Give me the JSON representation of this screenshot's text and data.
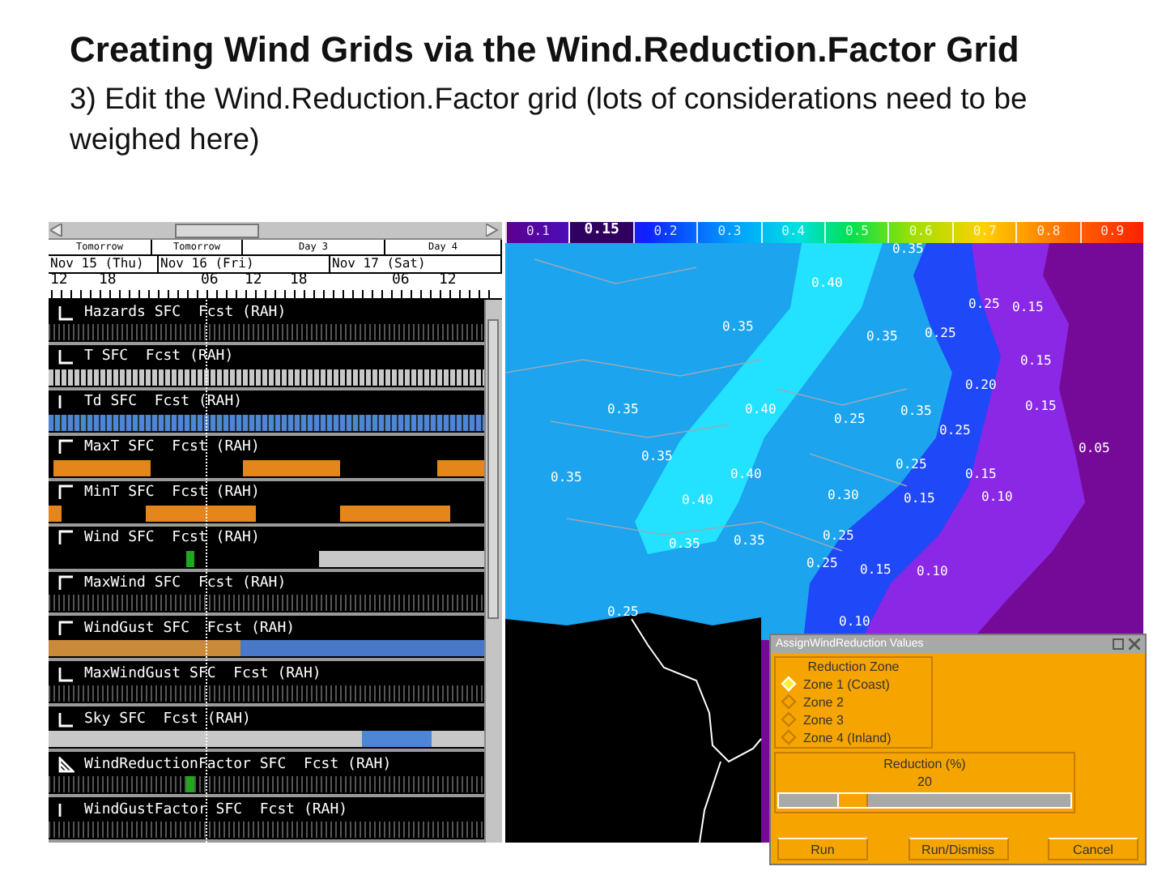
{
  "slide": {
    "title": "Creating Wind Grids via the Wind.Reduction.Factor Grid",
    "subtitle": "3) Edit the Wind.Reduction.Factor grid (lots of considerations need to be weighed here)"
  },
  "grid_manager": {
    "timeline": {
      "periods": [
        "Tomorrow",
        "Tomorrow",
        "Day 3",
        "Day 4"
      ],
      "days": [
        "Nov 15 (Thu)",
        "Nov 16 (Fri)",
        "Nov 17 (Sat)"
      ],
      "hours": [
        "12",
        "18",
        "06",
        "12",
        "18",
        "06",
        "12"
      ]
    },
    "grids": [
      {
        "label": "Hazards SFC  Fcst (RAH)",
        "marker": {
          "kind": "corner"
        },
        "strip": {
          "kind": "stipple"
        },
        "edited": false
      },
      {
        "label": "T SFC  Fcst (RAH)",
        "marker": {
          "kind": "corner"
        },
        "strip": {
          "kind": "gray"
        },
        "edited": false
      },
      {
        "label": "Td SFC  Fcst (RAH)",
        "marker": {
          "kind": "bar"
        },
        "strip": {
          "kind": "blue"
        },
        "edited": false
      },
      {
        "label": "MaxT SFC  Fcst (RAH)",
        "marker": {
          "kind": "top"
        },
        "strip": {
          "kind": "blocks"
        },
        "edited": false
      },
      {
        "label": "MinT SFC  Fcst (RAH)",
        "marker": {
          "kind": "top"
        },
        "strip": {
          "kind": "blocks2"
        },
        "edited": false
      },
      {
        "label": "Wind SFC  Fcst (RAH)",
        "marker": {
          "kind": "top"
        },
        "strip": {
          "kind": "wind"
        },
        "edited": true
      },
      {
        "label": "MaxWind SFC  Fcst (RAH)",
        "marker": {
          "kind": "top"
        },
        "strip": {
          "kind": "stipple"
        },
        "edited": false
      },
      {
        "label": "WindGust SFC  Fcst (RAH)",
        "marker": {
          "kind": "top"
        },
        "strip": {
          "kind": "gust"
        },
        "edited": false
      },
      {
        "label": "MaxWindGust SFC  Fcst (RAH)",
        "marker": {
          "kind": "corner"
        },
        "strip": {
          "kind": "stipple"
        },
        "edited": false
      },
      {
        "label": "Sky SFC  Fcst (RAH)",
        "marker": {
          "kind": "corner"
        },
        "strip": {
          "kind": "sky"
        },
        "edited": false
      },
      {
        "label": "WindReductionFactor SFC  Fcst (RAH)",
        "marker": {
          "kind": "diagonal"
        },
        "strip": {
          "kind": "stipple"
        },
        "edited": true
      },
      {
        "label": "WindGustFactor SFC  Fcst (RAH)",
        "marker": {
          "kind": "bar"
        },
        "strip": {
          "kind": "stipple"
        },
        "edited": false
      }
    ]
  },
  "map": {
    "legend": [
      {
        "label": "0.1",
        "selected": false
      },
      {
        "label": "0.15",
        "selected": true
      },
      {
        "label": "0.2",
        "selected": false
      },
      {
        "label": "0.3",
        "selected": false
      },
      {
        "label": "0.4",
        "selected": false
      },
      {
        "label": "0.5",
        "selected": false
      },
      {
        "label": "0.6",
        "selected": false
      },
      {
        "label": "0.7",
        "selected": false
      },
      {
        "label": "0.8",
        "selected": false
      },
      {
        "label": "0.9",
        "selected": false
      }
    ],
    "values": [
      "0.35",
      "0.40",
      "0.25",
      "0.15",
      "0.35",
      "0.35",
      "0.25",
      "0.15",
      "0.20",
      "0.35",
      "0.40",
      "0.25",
      "0.35",
      "0.15",
      "0.25",
      "0.35",
      "0.05",
      "0.35",
      "0.40",
      "0.25",
      "0.15",
      "0.40",
      "0.30",
      "0.15",
      "0.10",
      "0.35",
      "0.35",
      "0.25",
      "0.25",
      "0.15",
      "0.10",
      "0.25",
      "0.10"
    ]
  },
  "dialog": {
    "title": "AssignWindReduction Values",
    "group_title": "Reduction Zone",
    "zones": [
      {
        "label": "Zone 1 (Coast)",
        "selected": true
      },
      {
        "label": "Zone 2",
        "selected": false
      },
      {
        "label": "Zone 3",
        "selected": false
      },
      {
        "label": "Zone 4 (Inland)",
        "selected": false
      }
    ],
    "reduction": {
      "label": "Reduction (%)",
      "value": "20",
      "level": 0.22
    },
    "buttons": [
      "Run",
      "Run/Dismiss",
      "Cancel"
    ]
  }
}
